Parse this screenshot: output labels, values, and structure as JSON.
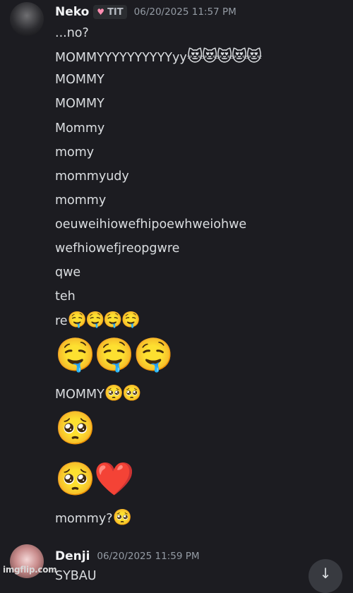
{
  "messages": [
    {
      "author": "Neko",
      "role_tag": "TIT",
      "timestamp": "06/20/2025 11:57 PM",
      "lines": [
        "...no?",
        "MOMMYYYYYYYYYYyy",
        "MOMMY",
        "MOMMY",
        "Mommy",
        "momy",
        "mommyudy",
        "mommy",
        "oeuweihiowefhipoewhweiohwe",
        "wefhiowefjreopgwre",
        "qwe",
        "teh",
        "re",
        "MOMMY",
        "mommy?"
      ],
      "emoji": {
        "heart_eyes_run": "😻😻😻😻😻",
        "drool_small": "🤤🤤🤤🤤",
        "drool_large": "🤤🤤🤤",
        "pleading_pair": "🥺🥺",
        "pleading_single": "🥺",
        "pleading_heart": "🥺❤️",
        "pleading_trail": "🥺"
      }
    },
    {
      "author": "Denji",
      "timestamp": "06/20/2025 11:59 PM",
      "lines": [
        "SYBAU"
      ]
    }
  ],
  "watermark": "imgflip.com",
  "icons": {
    "role_tag_icon": "heart-icon",
    "scroll_button_icon": "arrow-down-icon"
  }
}
